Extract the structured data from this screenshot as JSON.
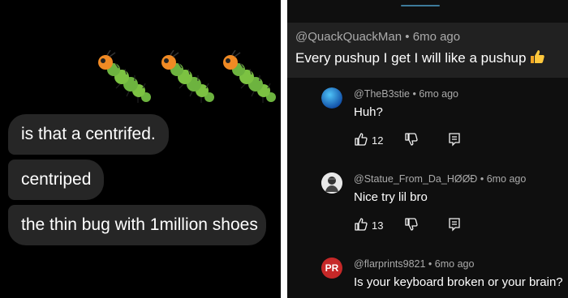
{
  "left_chat": {
    "messages": [
      {
        "text": "is that a centrifed."
      },
      {
        "text": "centriped"
      },
      {
        "text": "the thin bug with 1million shoes"
      }
    ],
    "emoji": [
      "caterpillar-emoji",
      "caterpillar-emoji",
      "caterpillar-emoji"
    ]
  },
  "comments": {
    "main": {
      "author": "@QuackQuackMan",
      "sep": "•",
      "time": "6mo ago",
      "text": "Every pushup I get I will like a pushup"
    },
    "replies": [
      {
        "author": "@TheB3stie",
        "sep": "•",
        "time": "6mo ago",
        "text": "Huh?",
        "likes": "12"
      },
      {
        "author": "@Statue_From_Da_ΗØØÐ",
        "sep": "•",
        "time": "6mo ago",
        "text": "Nice try lil bro",
        "likes": "13"
      },
      {
        "author": "@flarprints9821",
        "sep": "•",
        "time": "6mo ago",
        "text": "Is your keyboard broken or your brain?",
        "avatar_initials": "PR"
      }
    ]
  },
  "colors": {
    "bubble": "#262626",
    "left_bg": "#000000",
    "right_bg": "#0f0f0f",
    "highlight": "#212121",
    "avatar_pr": "#c62828"
  }
}
